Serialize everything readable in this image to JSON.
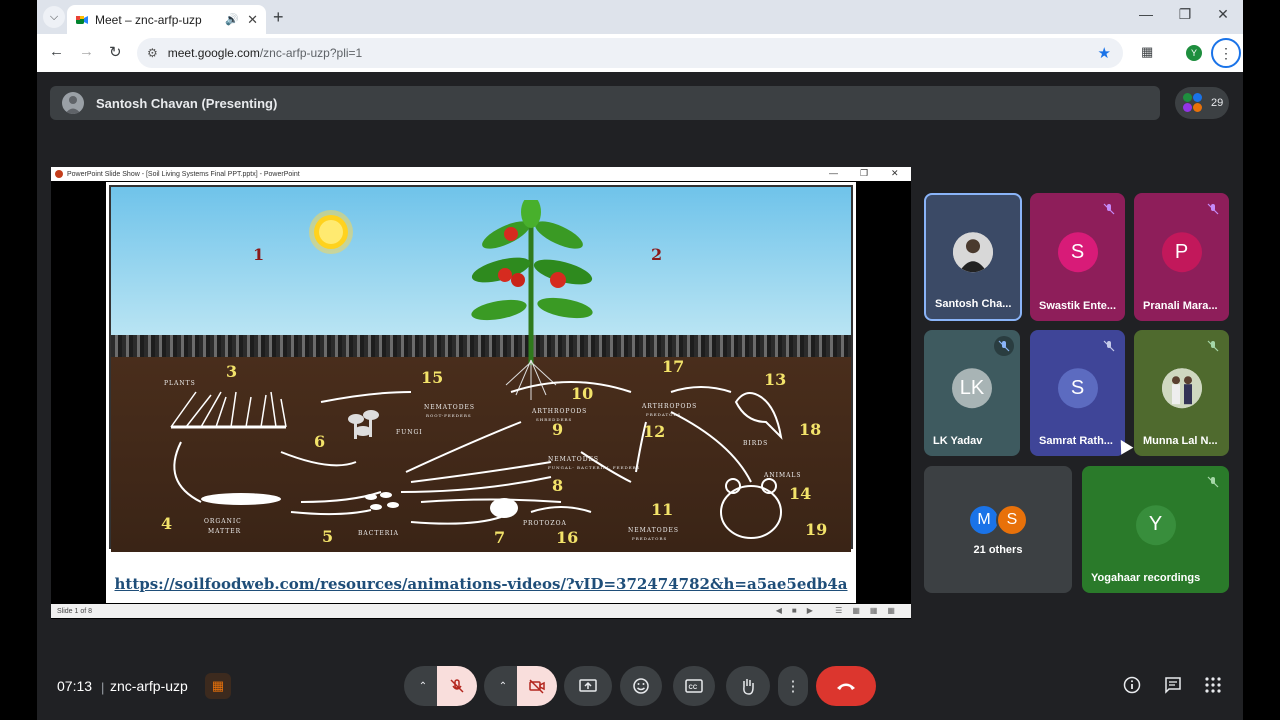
{
  "browser": {
    "tab_title": "Meet – znc-arfp-uzp",
    "url_host": "meet.google.com",
    "url_rest": "/znc-arfp-uzp?pli=1",
    "profile_initial": "Y"
  },
  "meeting": {
    "presenter_label": "Santosh Chavan (Presenting)",
    "participant_count": "29",
    "time": "07:13",
    "code": "znc-arfp-uzp"
  },
  "presentation": {
    "window_title": "PowerPoint Slide Show - [Soil Living Systems Final PPT.pptx] - PowerPoint",
    "status": "Slide 1 of 8",
    "link": "https://soilfoodweb.com/resources/animations-videos/?vID=372474782&h=a5ae5edb4a",
    "numbers_red": [
      "1",
      "2"
    ],
    "numbers_yellow": [
      "3",
      "4",
      "5",
      "6",
      "7",
      "8",
      "9",
      "10",
      "11",
      "12",
      "13",
      "14",
      "15",
      "16",
      "17",
      "18",
      "19"
    ],
    "captions": {
      "plants": "PLANTS",
      "organic_1": "ORGANIC",
      "organic_2": "MATTER",
      "bacteria": "BACTERIA",
      "fungi": "FUNGI",
      "protozoa": "PROTOZOA",
      "nematodes_root_1": "NEMATODES",
      "nematodes_root_2": "ROOT-FEEDERS",
      "nematodes_fb_1": "NEMATODES",
      "nematodes_fb_2": "FUNGAL- BACTERIAL FEEDERS",
      "nematodes_pred_1": "NEMATODES",
      "nematodes_pred_2": "PREDATORS",
      "arthropods_shred_1": "ARTHROPODS",
      "arthropods_shred_2": "SHREDDERS",
      "arthropods_pred_1": "ARTHROPODS",
      "arthropods_pred_2": "PREDATORS",
      "birds": "BIRDS",
      "animals": "ANIMALS"
    }
  },
  "tiles": [
    {
      "name": "Santosh Cha...",
      "initial": "",
      "color": "#3b4a66"
    },
    {
      "name": "Swastik Ente...",
      "initial": "S",
      "color": "#8e1e5a"
    },
    {
      "name": "Pranali Mara...",
      "initial": "P",
      "color": "#8e1e5a"
    },
    {
      "name": "LK Yadav",
      "initial": "LK",
      "color": "#3e5a5f"
    },
    {
      "name": "Samrat Rath...",
      "initial": "S",
      "color": "#3f4598"
    },
    {
      "name": "Munna Lal N...",
      "initial": "",
      "color": "#4f6a2e"
    },
    {
      "name": "Yogahaar recordings",
      "initial": "Y",
      "color": "#2a7a2a"
    }
  ],
  "others": {
    "label": "21 others",
    "initial_1": "M",
    "initial_2": "S"
  },
  "icons": {
    "mic": "mic-off-icon",
    "cam": "camera-off-icon",
    "present": "present-icon",
    "emoji": "emoji-icon",
    "captions": "captions-icon",
    "hand": "raise-hand-icon",
    "more": "more-options-icon",
    "end": "end-call-icon",
    "info": "info-icon",
    "chat": "chat-icon",
    "activities": "activities-icon"
  }
}
